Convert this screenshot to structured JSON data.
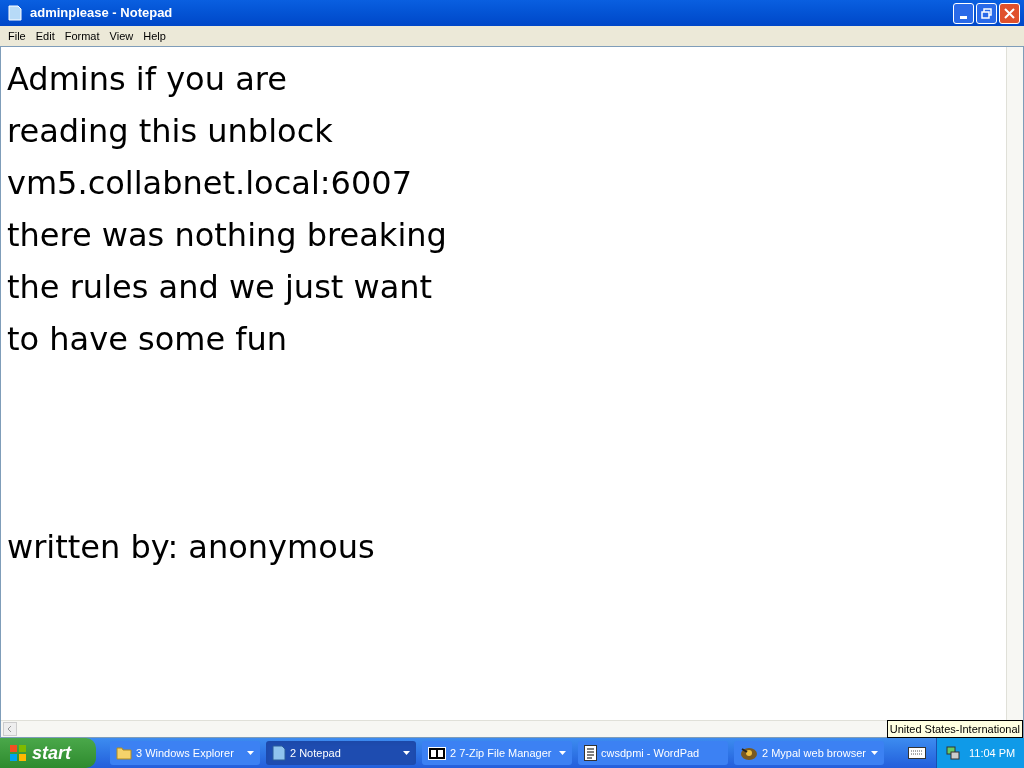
{
  "window": {
    "title": "adminplease - Notepad"
  },
  "menu": [
    "File",
    "Edit",
    "Format",
    "View",
    "Help"
  ],
  "document": {
    "lines": [
      "Admins if you are",
      "reading this unblock",
      "vm5.collabnet.local:6007",
      "there was nothing breaking",
      "the rules and we just want",
      "to have some fun"
    ],
    "signature": "written by: anonymous"
  },
  "taskbar": {
    "start": "start",
    "buttons": [
      {
        "label": "3 Windows Explorer",
        "kind": "folder",
        "grouped": true,
        "selected": false
      },
      {
        "label": "2 Notepad",
        "kind": "notepad",
        "grouped": true,
        "selected": true
      },
      {
        "label": "2 7-Zip File Manager",
        "kind": "archive",
        "grouped": true,
        "selected": false
      },
      {
        "label": "cwsdpmi - WordPad",
        "kind": "wordpad",
        "grouped": false,
        "selected": false
      },
      {
        "label": "2 Mypal web browser",
        "kind": "browser",
        "grouped": true,
        "selected": false
      }
    ],
    "tooltip": "United States-International",
    "clock": "11:04 PM"
  }
}
